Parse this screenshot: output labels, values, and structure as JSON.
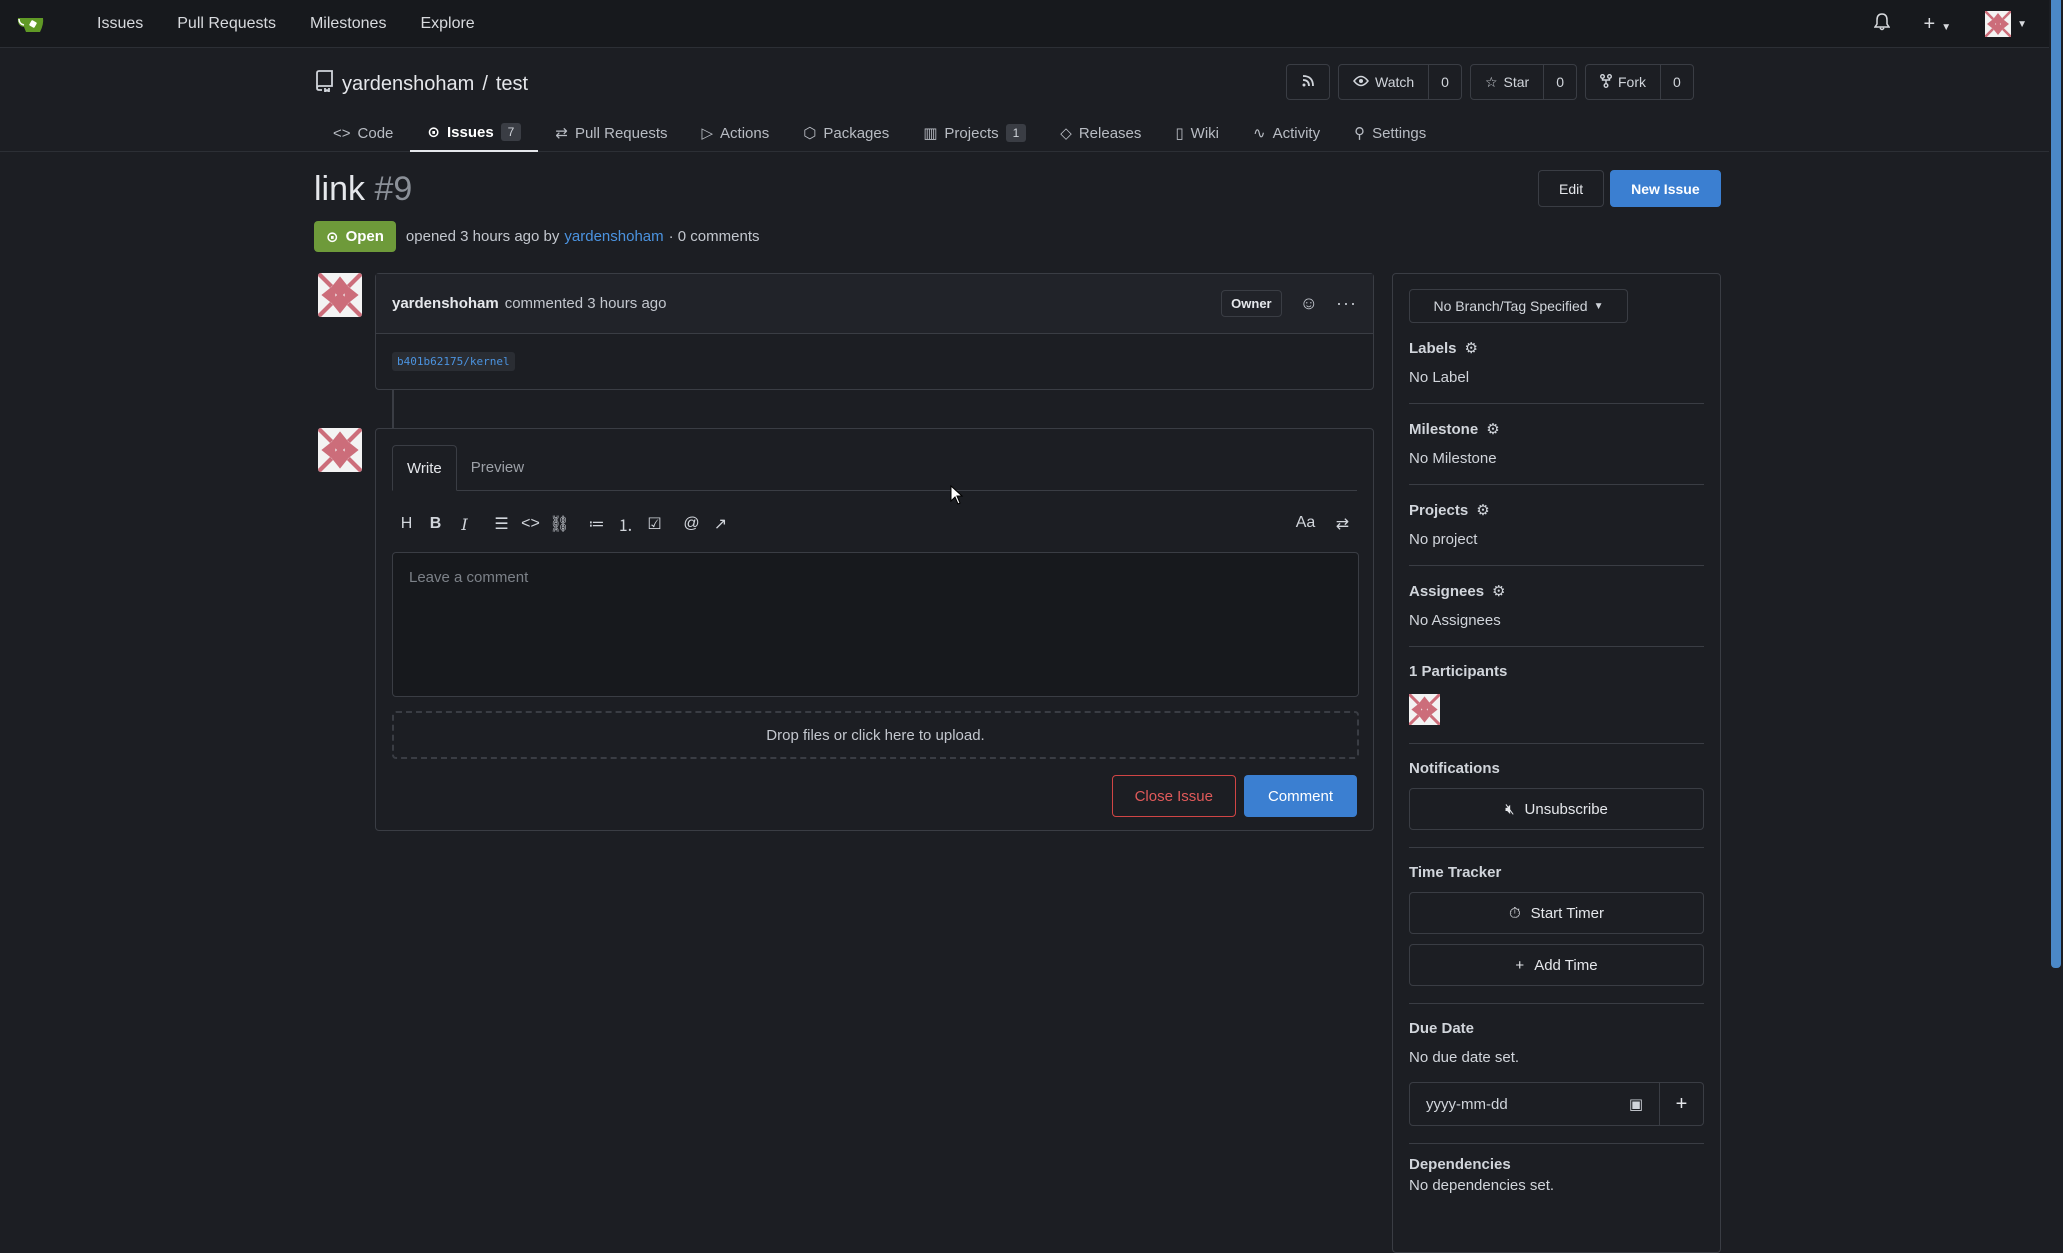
{
  "topbar": {
    "nav": [
      "Issues",
      "Pull Requests",
      "Milestones",
      "Explore"
    ]
  },
  "repo": {
    "owner": "yardenshoham",
    "separator": "/",
    "name": "test",
    "watch_label": "Watch",
    "watch_count": "0",
    "star_label": "Star",
    "star_count": "0",
    "fork_label": "Fork",
    "fork_count": "0"
  },
  "tabs": [
    {
      "label": "Code"
    },
    {
      "label": "Issues",
      "badge": "7"
    },
    {
      "label": "Pull Requests"
    },
    {
      "label": "Actions"
    },
    {
      "label": "Packages"
    },
    {
      "label": "Projects",
      "badge": "1"
    },
    {
      "label": "Releases"
    },
    {
      "label": "Wiki"
    },
    {
      "label": "Activity"
    },
    {
      "label": "Settings"
    }
  ],
  "issue": {
    "title": "link",
    "number": "#9",
    "edit_label": "Edit",
    "new_issue_label": "New Issue",
    "status": "Open",
    "opened_text": "opened 3 hours ago by",
    "author": "yardenshoham",
    "comments_text": "· 0 comments"
  },
  "comment": {
    "author": "yardenshoham",
    "action": "commented 3 hours ago",
    "role": "Owner",
    "body_ref": "b401b62175/kernel"
  },
  "editor": {
    "write_tab": "Write",
    "preview_tab": "Preview",
    "placeholder": "Leave a comment",
    "dropzone": "Drop files or click here to upload.",
    "close_label": "Close Issue",
    "comment_label": "Comment"
  },
  "sidebar": {
    "branch": "No Branch/Tag Specified",
    "labels_title": "Labels",
    "labels_value": "No Label",
    "milestone_title": "Milestone",
    "milestone_value": "No Milestone",
    "projects_title": "Projects",
    "projects_value": "No project",
    "assignees_title": "Assignees",
    "assignees_value": "No Assignees",
    "participants_title": "1 Participants",
    "notifications_title": "Notifications",
    "unsubscribe_label": "Unsubscribe",
    "time_tracker_title": "Time Tracker",
    "start_timer_label": "Start Timer",
    "add_time_label": "Add Time",
    "due_date_title": "Due Date",
    "due_date_value": "No due date set.",
    "date_placeholder": "yyyy-mm-dd",
    "dependencies_title": "Dependencies",
    "dependencies_value": "No dependencies set."
  },
  "colors": {
    "accent": "#3b7fd1",
    "open": "#6e9a3a",
    "danger": "#d04545"
  }
}
